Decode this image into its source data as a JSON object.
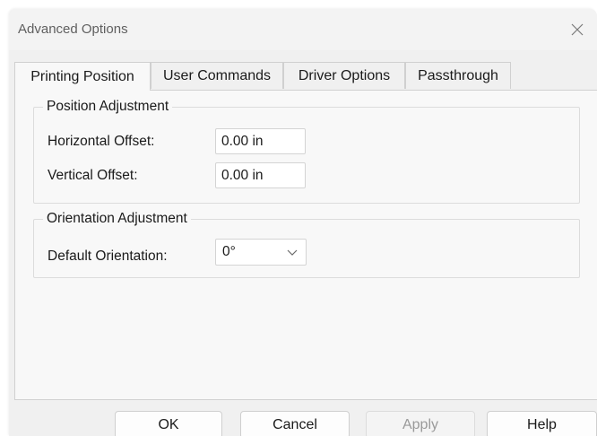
{
  "window": {
    "title": "Advanced Options",
    "close_icon": "close-icon"
  },
  "tabs": [
    {
      "label": "Printing Position",
      "active": true
    },
    {
      "label": "User Commands",
      "active": false
    },
    {
      "label": "Driver Options",
      "active": false
    },
    {
      "label": "Passthrough",
      "active": false
    }
  ],
  "position_adjustment": {
    "legend": "Position Adjustment",
    "horizontal_offset": {
      "label": "Horizontal Offset:",
      "value": "0.00 in"
    },
    "vertical_offset": {
      "label": "Vertical Offset:",
      "value": "0.00 in"
    }
  },
  "orientation_adjustment": {
    "legend": "Orientation Adjustment",
    "default_orientation": {
      "label": "Default Orientation:",
      "value": "0°",
      "icon": "chevron-down-icon"
    }
  },
  "buttons": {
    "ok": "OK",
    "cancel": "Cancel",
    "apply": "Apply",
    "help": "Help"
  }
}
